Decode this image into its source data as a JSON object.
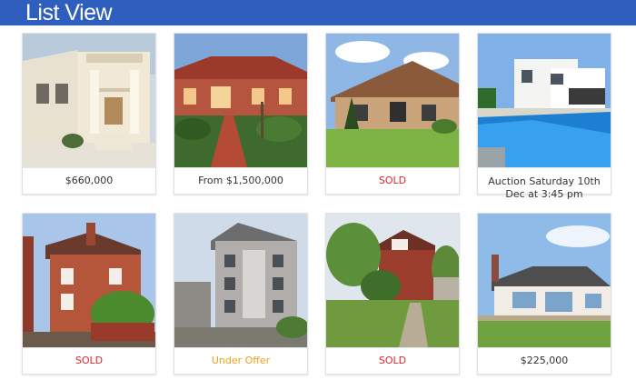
{
  "header": {
    "title": "List View"
  },
  "listings": [
    {
      "price": "$660,000",
      "status": "normal",
      "image": "cream-two-storey-villa"
    },
    {
      "price": "From $1,500,000",
      "status": "normal",
      "image": "red-brick-federation-house"
    },
    {
      "price": "SOLD",
      "status": "sold",
      "image": "brick-bungalow-with-lawn"
    },
    {
      "price": "Auction Saturday 10th Dec at 3:45 pm",
      "status": "auction",
      "image": "modern-house-with-pool"
    },
    {
      "price": "SOLD",
      "status": "sold",
      "image": "red-brick-terrace-house"
    },
    {
      "price": "Under Offer",
      "status": "offer",
      "image": "grey-apartment-building"
    },
    {
      "price": "SOLD",
      "status": "sold",
      "image": "brick-house-with-trees"
    },
    {
      "price": "$225,000",
      "status": "normal",
      "image": "white-bungalow"
    }
  ],
  "colors": {
    "header": "#2f5fbe",
    "sold": "#e0262d",
    "under_offer": "#f0a020"
  }
}
